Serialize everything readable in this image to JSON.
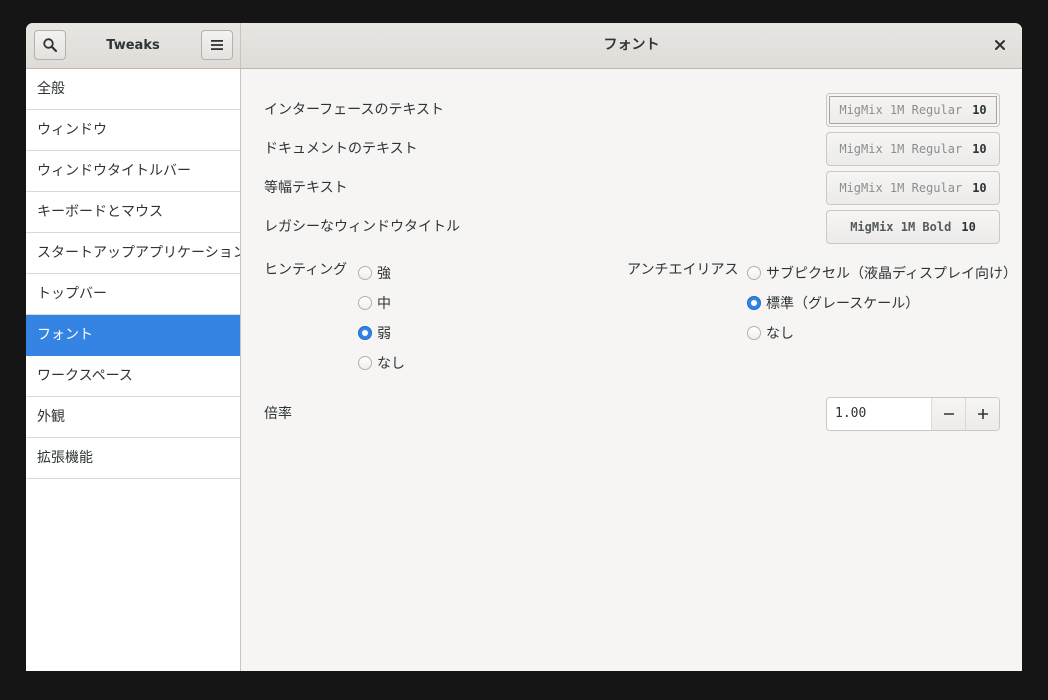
{
  "header": {
    "app_title": "Tweaks",
    "page_title": "フォント"
  },
  "icons": {
    "search": "search-icon",
    "menu": "hamburger-menu-icon",
    "close": "close-icon",
    "minus": "minus-icon",
    "plus": "plus-icon"
  },
  "colors": {
    "accent": "#3584e4",
    "window_bg": "#f6f5f4",
    "sidebar_bg": "#ffffff"
  },
  "sidebar": {
    "selected_index": 6,
    "items": [
      {
        "label": "全般"
      },
      {
        "label": "ウィンドウ"
      },
      {
        "label": "ウィンドウタイトルバー"
      },
      {
        "label": "キーボードとマウス"
      },
      {
        "label": "スタートアップアプリケーション"
      },
      {
        "label": "トップバー"
      },
      {
        "label": "フォント"
      },
      {
        "label": "ワークスペース"
      },
      {
        "label": "外観"
      },
      {
        "label": "拡張機能"
      }
    ]
  },
  "fonts": {
    "interface": {
      "label": "インターフェースのテキスト",
      "font": "MigMix 1M Regular",
      "size": "10"
    },
    "document": {
      "label": "ドキュメントのテキスト",
      "font": "MigMix 1M Regular",
      "size": "10"
    },
    "monospace": {
      "label": "等幅テキスト",
      "font": "MigMix 1M Regular",
      "size": "10"
    },
    "legacy_title": {
      "label": "レガシーなウィンドウタイトル",
      "font": "MigMix 1M Bold",
      "size": "10"
    }
  },
  "hinting": {
    "label": "ヒンティング",
    "selected": "弱",
    "options": [
      "強",
      "中",
      "弱",
      "なし"
    ]
  },
  "antialiasing": {
    "label": "アンチエイリアス",
    "selected": "標準（グレースケール）",
    "options": [
      "サブピクセル（液晶ディスプレイ向け）",
      "標準（グレースケール）",
      "なし"
    ]
  },
  "scale": {
    "label": "倍率",
    "value": "1.00"
  }
}
